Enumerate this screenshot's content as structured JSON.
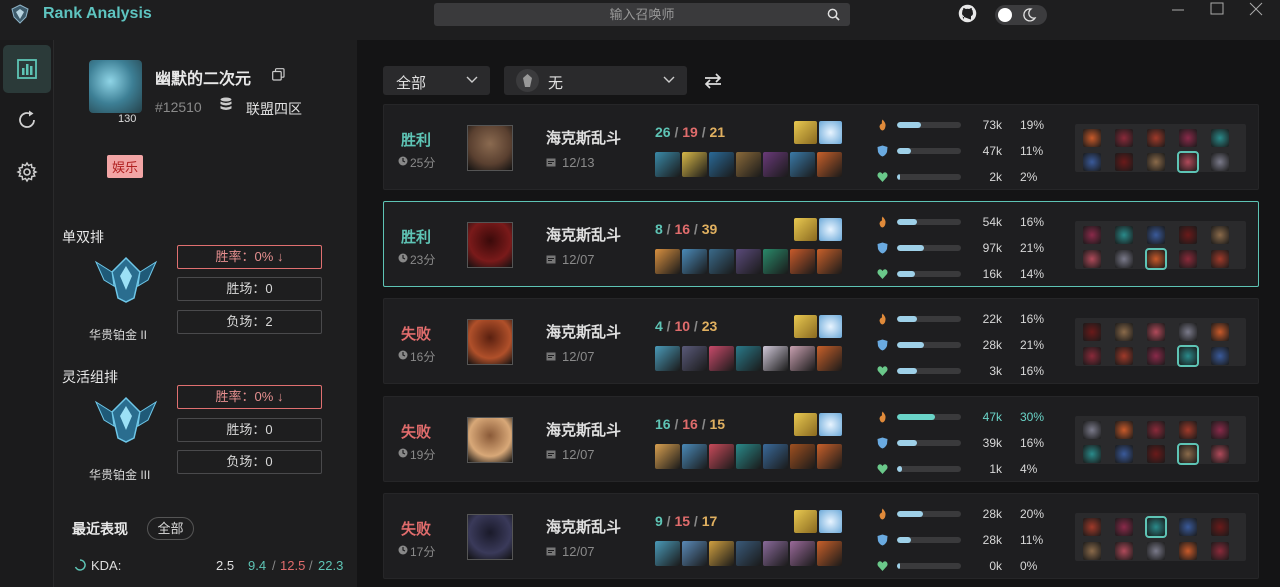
{
  "app": {
    "title": "Rank Analysis"
  },
  "search": {
    "placeholder": "输入召唤师"
  },
  "profile": {
    "name": "幽默的二次元",
    "tag": "#12510",
    "server": "联盟四区",
    "level": "130",
    "badge": "娱乐"
  },
  "ranks": [
    {
      "queue": "单双排",
      "tier": "华贵铂金 II",
      "winrate": "胜率：0% ↓",
      "wins": "胜场：0",
      "losses": "负场：2"
    },
    {
      "queue": "灵活组排",
      "tier": "华贵铂金 III",
      "winrate": "胜率：0% ↓",
      "wins": "胜场：0",
      "losses": "负场：0"
    }
  ],
  "recent": {
    "title": "最近表现",
    "filter": "全部",
    "kda_label": "KDA:",
    "kda_ratio": "2.5",
    "kda_k": "9.4",
    "kda_d": "12.5",
    "kda_a": "22.3"
  },
  "filters": {
    "mode": "全部",
    "champion": "无"
  },
  "icons": {
    "logo": "app-logo-icon",
    "search": "search-icon",
    "github": "github-icon",
    "theme": "moon-icon",
    "nav": [
      "chart-icon",
      "refresh-icon",
      "gear-icon"
    ]
  },
  "colors": {
    "accent": "#5ec4b5",
    "win": "#5ec4b5",
    "loss": "#e06c6c",
    "assist": "#e0b060"
  },
  "matches": [
    {
      "result": "胜利",
      "win": true,
      "duration": "25分",
      "mode": "海克斯乱斗",
      "date": "12/13",
      "k": "26",
      "d": "19",
      "a": "21",
      "dmg": "73k",
      "dmg_pct": "19%",
      "dmg_frac": 0.19,
      "taken": "47k",
      "taken_pct": "11%",
      "taken_frac": 0.11,
      "heal": "2k",
      "heal_pct": "2%",
      "heal_frac": 0.02,
      "selected": false,
      "me": 8
    },
    {
      "result": "胜利",
      "win": true,
      "duration": "23分",
      "mode": "海克斯乱斗",
      "date": "12/07",
      "k": "8",
      "d": "16",
      "a": "39",
      "dmg": "54k",
      "dmg_pct": "16%",
      "dmg_frac": 0.16,
      "taken": "97k",
      "taken_pct": "21%",
      "taken_frac": 0.21,
      "heal": "16k",
      "heal_pct": "14%",
      "heal_frac": 0.14,
      "selected": true,
      "me": 7
    },
    {
      "result": "失败",
      "win": false,
      "duration": "16分",
      "mode": "海克斯乱斗",
      "date": "12/07",
      "k": "4",
      "d": "10",
      "a": "23",
      "dmg": "22k",
      "dmg_pct": "16%",
      "dmg_frac": 0.16,
      "taken": "28k",
      "taken_pct": "21%",
      "taken_frac": 0.21,
      "heal": "3k",
      "heal_pct": "16%",
      "heal_frac": 0.16,
      "selected": false,
      "me": 8
    },
    {
      "result": "失败",
      "win": false,
      "duration": "19分",
      "mode": "海克斯乱斗",
      "date": "12/07",
      "k": "16",
      "d": "16",
      "a": "15",
      "dmg": "47k",
      "dmg_pct": "30%",
      "dmg_frac": 0.3,
      "taken": "39k",
      "taken_pct": "16%",
      "taken_frac": 0.16,
      "heal": "1k",
      "heal_pct": "4%",
      "heal_frac": 0.04,
      "selected": false,
      "me": 8
    },
    {
      "result": "失败",
      "win": false,
      "duration": "17分",
      "mode": "海克斯乱斗",
      "date": "12/07",
      "k": "9",
      "d": "15",
      "a": "17",
      "dmg": "28k",
      "dmg_pct": "20%",
      "dmg_frac": 0.2,
      "taken": "28k",
      "taken_pct": "11%",
      "taken_frac": 0.11,
      "heal": "0k",
      "heal_pct": "0%",
      "heal_frac": 0.0,
      "selected": false,
      "me": 2
    }
  ]
}
